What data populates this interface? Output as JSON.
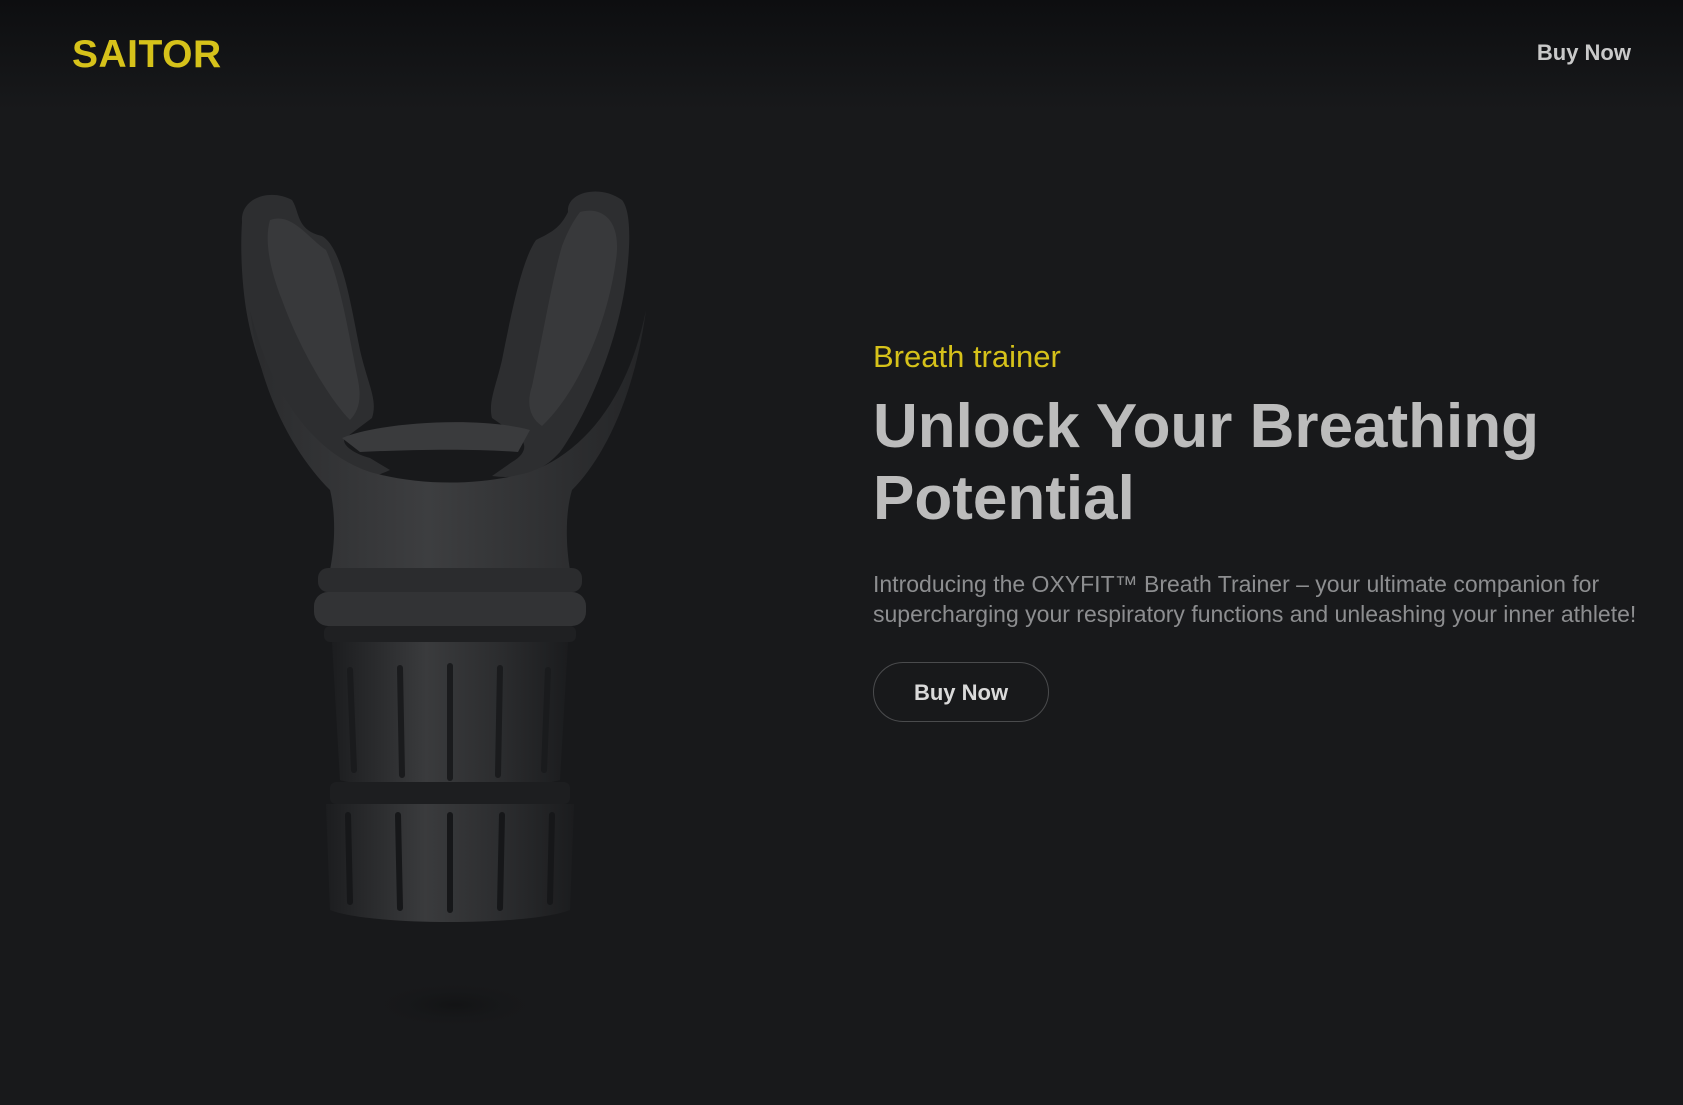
{
  "header": {
    "logo": "SAITOR",
    "nav_buy_label": "Buy Now"
  },
  "hero": {
    "eyebrow": "Breath trainer",
    "headline": "Unlock Your Breathing Potential",
    "description": "Introducing the OXYFIT™ Breath Trainer – your ultimate companion for supercharging your respiratory functions and unleashing your inner athlete!",
    "cta_label": "Buy Now"
  },
  "colors": {
    "background": "#18191b",
    "accent": "#d6c21a",
    "headline": "#bcbcbc",
    "body_text": "#8d8e90"
  },
  "icons": {
    "product_image": "breath-trainer-mouthpiece"
  }
}
